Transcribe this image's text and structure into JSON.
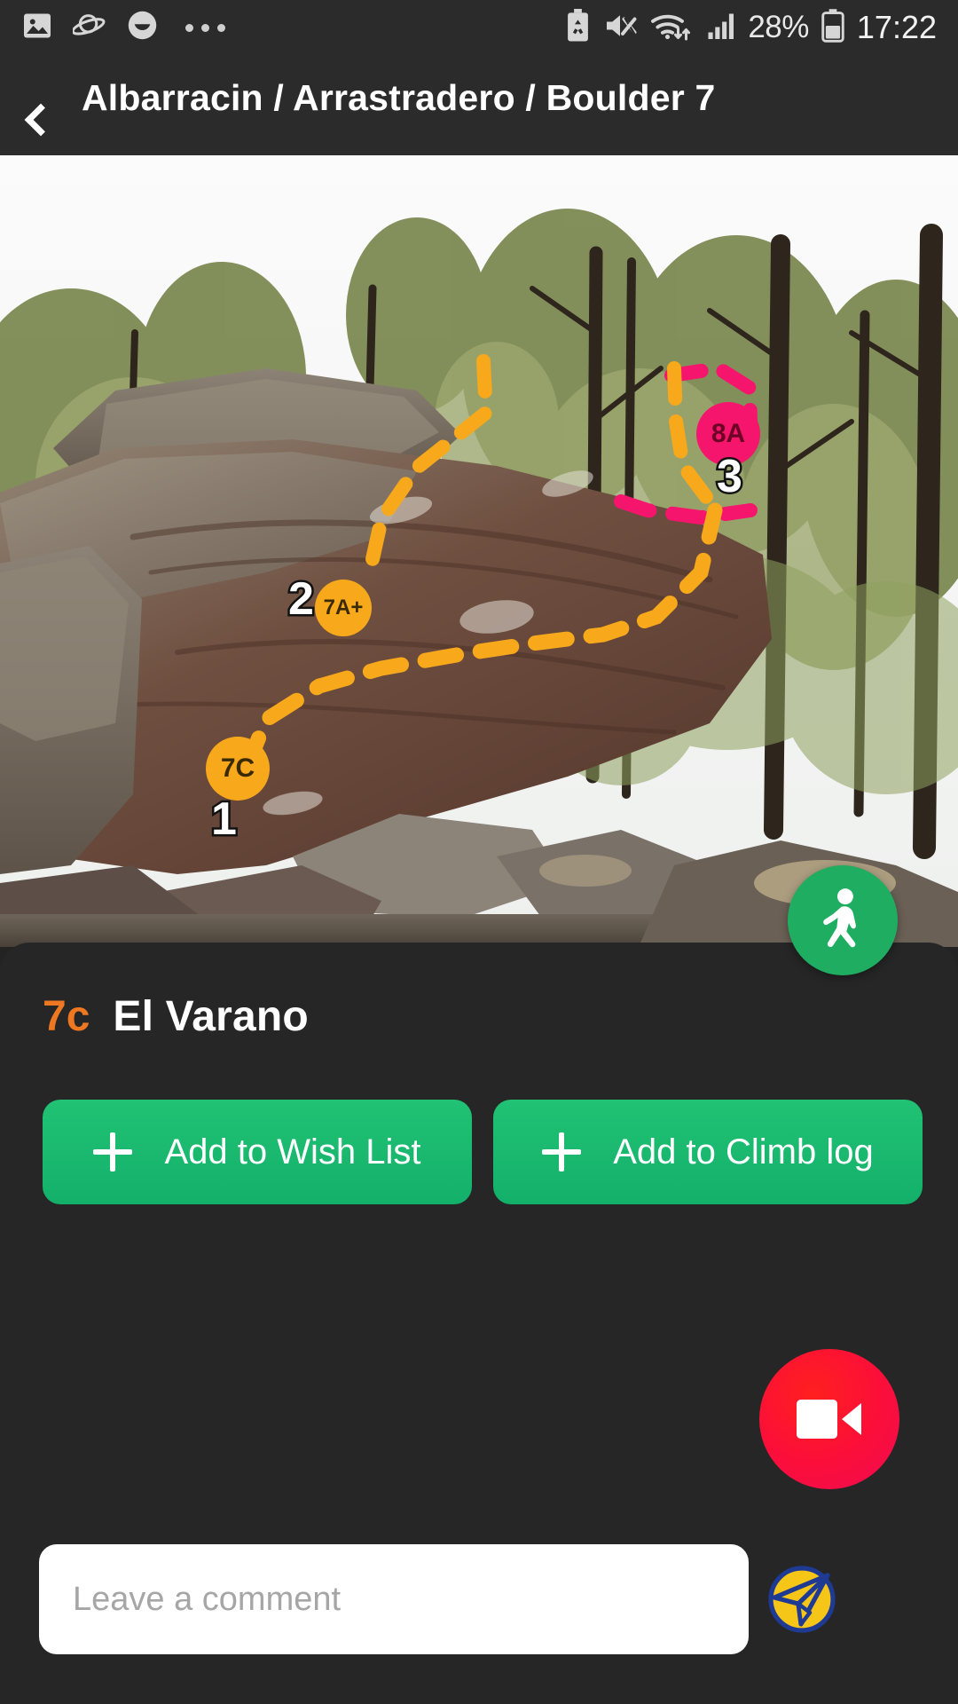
{
  "status_bar": {
    "left_icons": [
      "image-icon",
      "planet-icon",
      "smiley-icon",
      "more-dots-icon"
    ],
    "right_icons": [
      "battery-saver-icon",
      "mute-icon",
      "wifi-icon",
      "signal-icon",
      "battery-icon"
    ],
    "battery_percent": "28%",
    "clock": "17:22"
  },
  "app_bar": {
    "back_label": "back",
    "title": "Albarracin / Arrastradero / Boulder 7"
  },
  "photo": {
    "alt": "Boulder with route topo overlay",
    "routes": [
      {
        "number": "1",
        "grade": "7C",
        "color": "#F7A81B"
      },
      {
        "number": "2",
        "grade": "7A+",
        "color": "#F7A81B"
      },
      {
        "number": "3",
        "grade": "8A",
        "color": "#F5156C"
      }
    ],
    "walk_fab": {
      "icon": "walking-person-icon",
      "color": "#1FAD62"
    }
  },
  "route": {
    "grade": "7c",
    "grade_color": "#EE7722",
    "name": "El Varano"
  },
  "actions": {
    "wish_list_label": "Add to Wish List",
    "climb_log_label": "Add to Climb log",
    "accent_color": "#17B96E"
  },
  "video_button": {
    "icon": "video-camera-icon",
    "color": "#FB0E3A"
  },
  "comment": {
    "placeholder": "Leave a comment",
    "value": "",
    "send_icon": "send-paper-plane-icon",
    "send_bg_color": "#F5C518",
    "send_stroke_color": "#1F3A93"
  }
}
